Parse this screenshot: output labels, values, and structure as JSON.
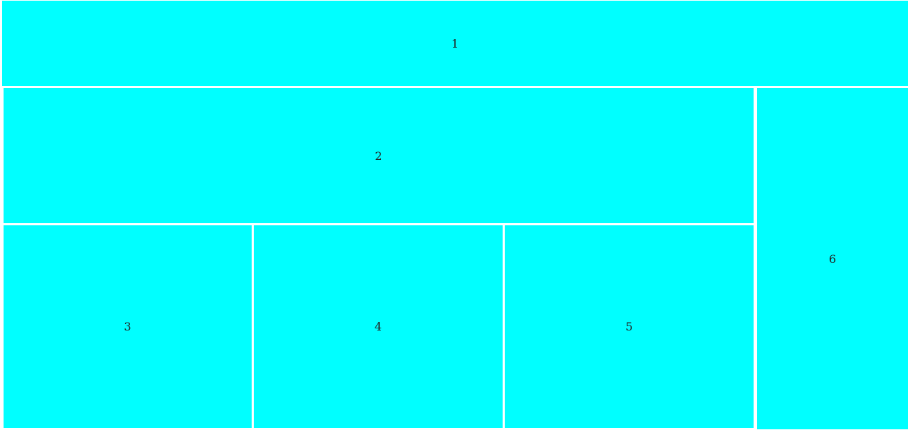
{
  "colors": {
    "tile_fill": "#00ffff",
    "gap": "#ffffff",
    "text": "#222222"
  },
  "tiles": [
    {
      "label": "1"
    },
    {
      "label": "2"
    },
    {
      "label": "3"
    },
    {
      "label": "4"
    },
    {
      "label": "5"
    },
    {
      "label": "6"
    }
  ]
}
